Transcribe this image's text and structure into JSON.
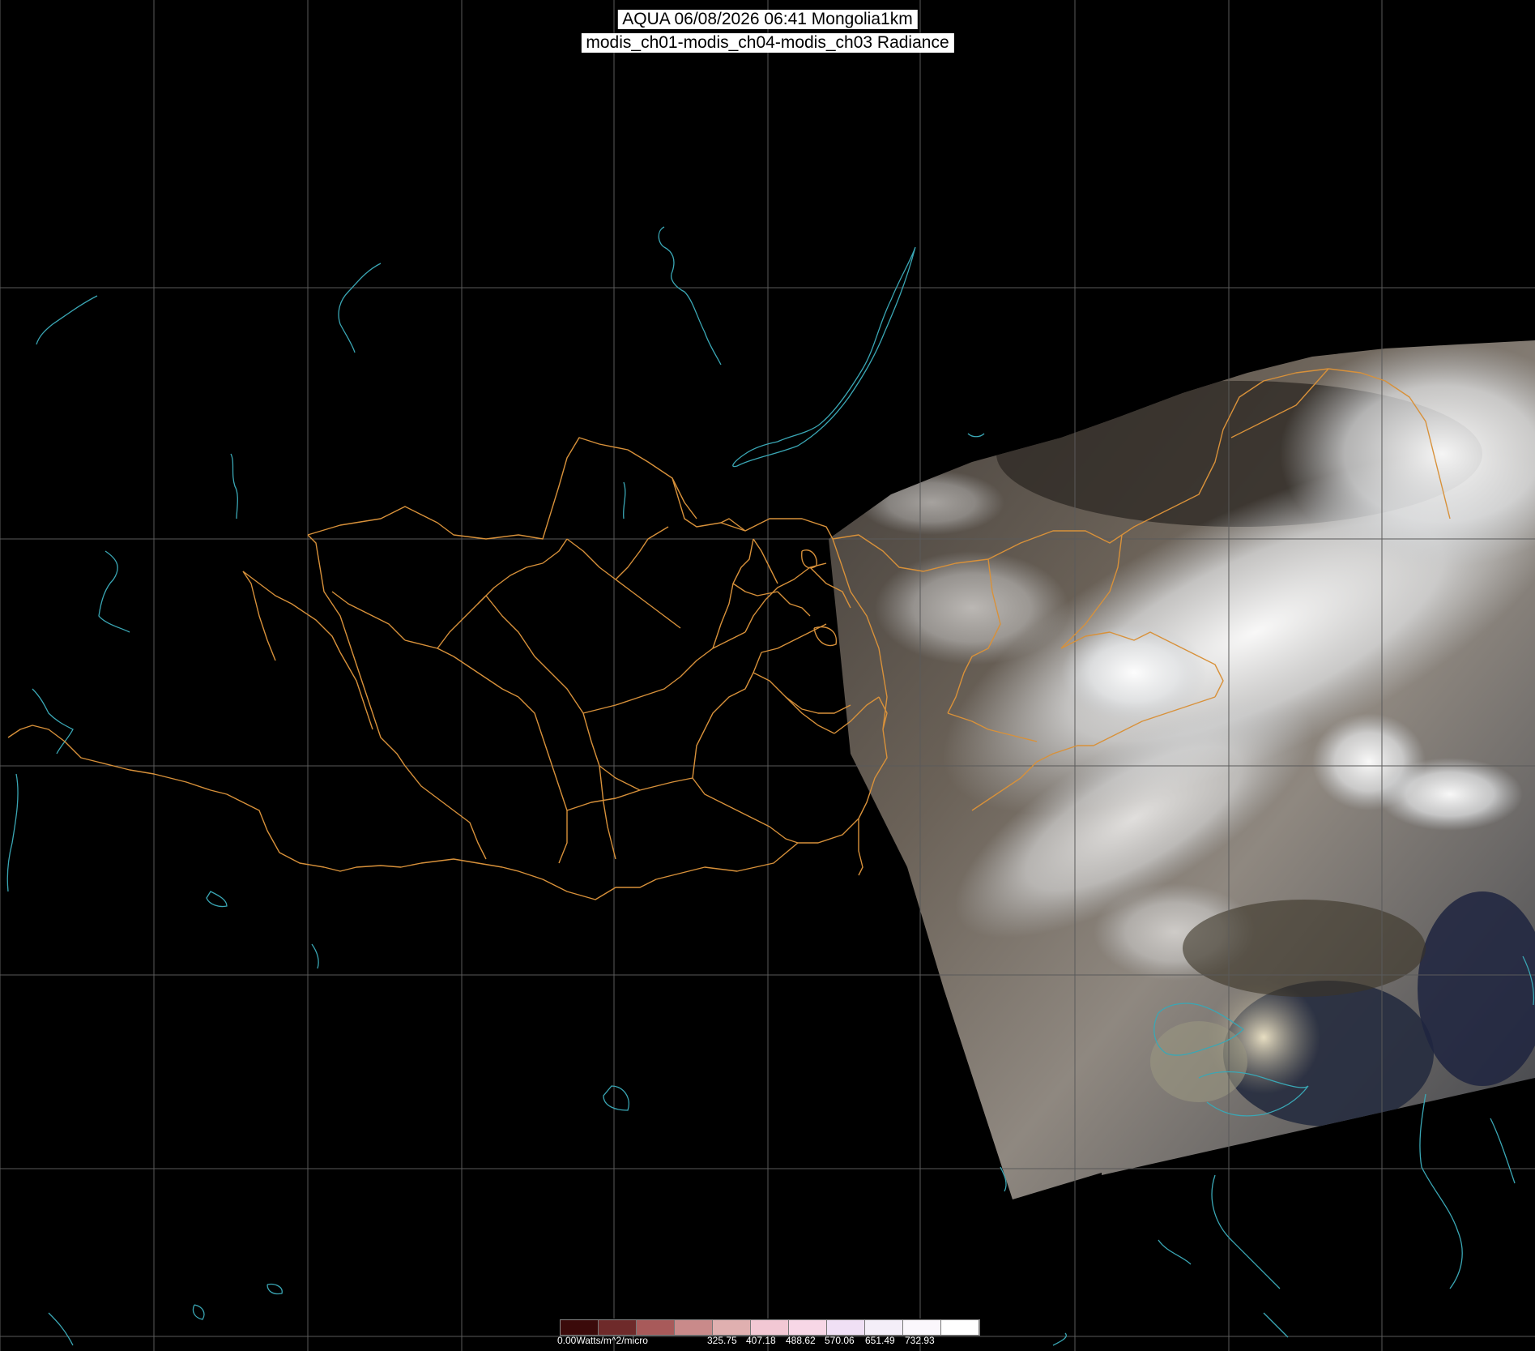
{
  "title": {
    "line1": "AQUA 06/08/2026 06:41 Mongolia1km",
    "line2": "modis_ch01-modis_ch04-modis_ch03 Radiance"
  },
  "legend": {
    "ticks": [
      "0.00Watts/m^2/micro",
      "325.75",
      "407.18",
      "488.62",
      "570.06",
      "651.49",
      "732.93"
    ],
    "colors": [
      "#3b0a0a",
      "#6e2a2a",
      "#a85a5a",
      "#c98a8a",
      "#e0b0b0",
      "#f2c8d4",
      "#f7d7e6",
      "#f0e0f5",
      "#f4eef8",
      "#fbf7fc",
      "#ffffff"
    ]
  },
  "colors": {
    "background": "#000000",
    "grid": "#5a5a5a",
    "borders": "#d8913a",
    "water": "#3aa7b5"
  }
}
